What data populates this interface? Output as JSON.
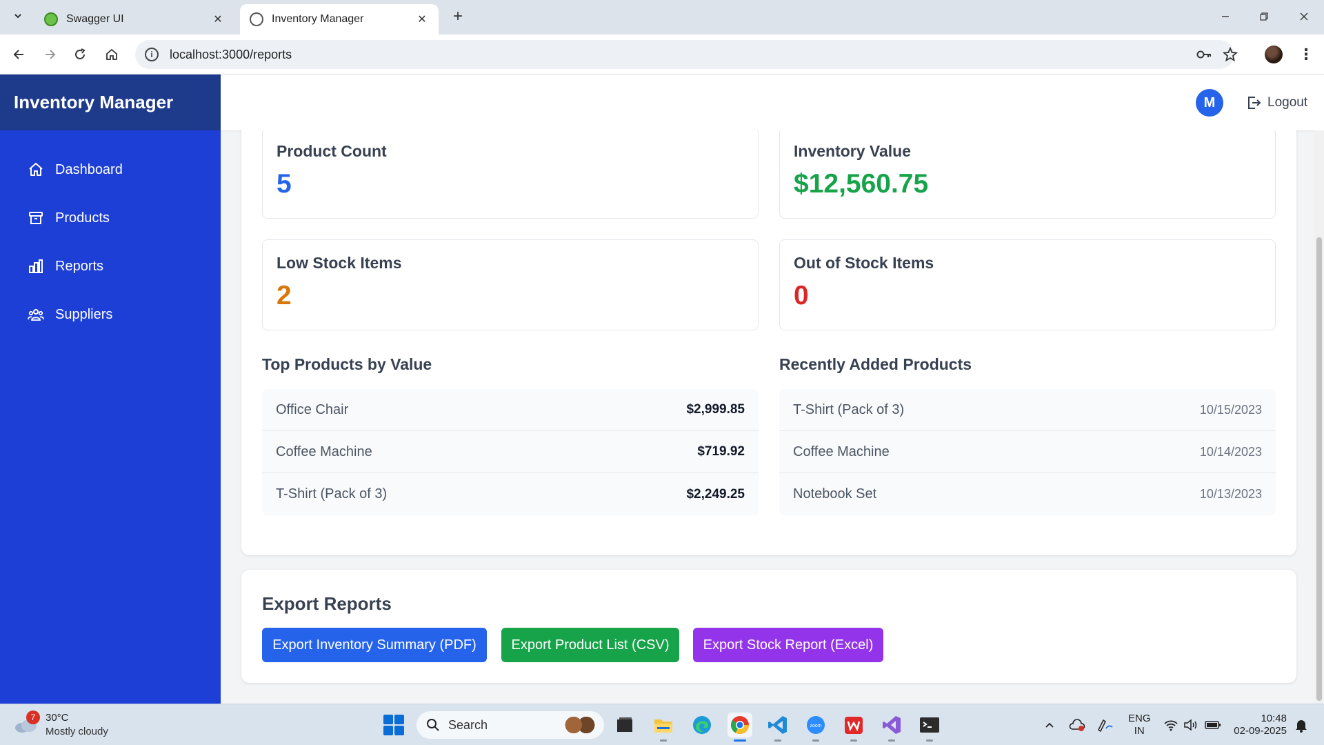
{
  "browser": {
    "tabs": [
      {
        "title": "Swagger UI",
        "active": false
      },
      {
        "title": "Inventory Manager",
        "active": true
      }
    ],
    "url": "localhost:3000/reports"
  },
  "app": {
    "title": "Inventory Manager",
    "nav": [
      {
        "label": "Dashboard",
        "icon": "home-icon"
      },
      {
        "label": "Products",
        "icon": "archive-box-icon"
      },
      {
        "label": "Reports",
        "icon": "bar-chart-icon"
      },
      {
        "label": "Suppliers",
        "icon": "users-icon"
      }
    ],
    "user": {
      "initial": "M"
    },
    "logout_label": "Logout"
  },
  "stats": [
    {
      "label": "Product Count",
      "value": "5",
      "color": "#2563eb"
    },
    {
      "label": "Inventory Value",
      "value": "$12,560.75",
      "color": "#16a34a"
    },
    {
      "label": "Low Stock Items",
      "value": "2",
      "color": "#d97706"
    },
    {
      "label": "Out of Stock Items",
      "value": "0",
      "color": "#dc2626"
    }
  ],
  "top_products": {
    "title": "Top Products by Value",
    "rows": [
      {
        "name": "Office Chair",
        "value": "$2,999.85"
      },
      {
        "name": "Coffee Machine",
        "value": "$719.92"
      },
      {
        "name": "T-Shirt (Pack of 3)",
        "value": "$2,249.25"
      }
    ]
  },
  "recent_products": {
    "title": "Recently Added Products",
    "rows": [
      {
        "name": "T-Shirt (Pack of 3)",
        "date": "10/15/2023"
      },
      {
        "name": "Coffee Machine",
        "date": "10/14/2023"
      },
      {
        "name": "Notebook Set",
        "date": "10/13/2023"
      }
    ]
  },
  "export": {
    "title": "Export Reports",
    "buttons": [
      {
        "label": "Export Inventory Summary (PDF)",
        "color": "#2563eb"
      },
      {
        "label": "Export Product List (CSV)",
        "color": "#16a34a"
      },
      {
        "label": "Export Stock Report (Excel)",
        "color": "#9333ea"
      }
    ]
  },
  "taskbar": {
    "weather": {
      "temp": "30°C",
      "desc": "Mostly cloudy",
      "badge": "7"
    },
    "search_placeholder": "Search",
    "lang": {
      "line1": "ENG",
      "line2": "IN"
    },
    "clock": {
      "time": "10:48",
      "date": "02-09-2025"
    }
  }
}
